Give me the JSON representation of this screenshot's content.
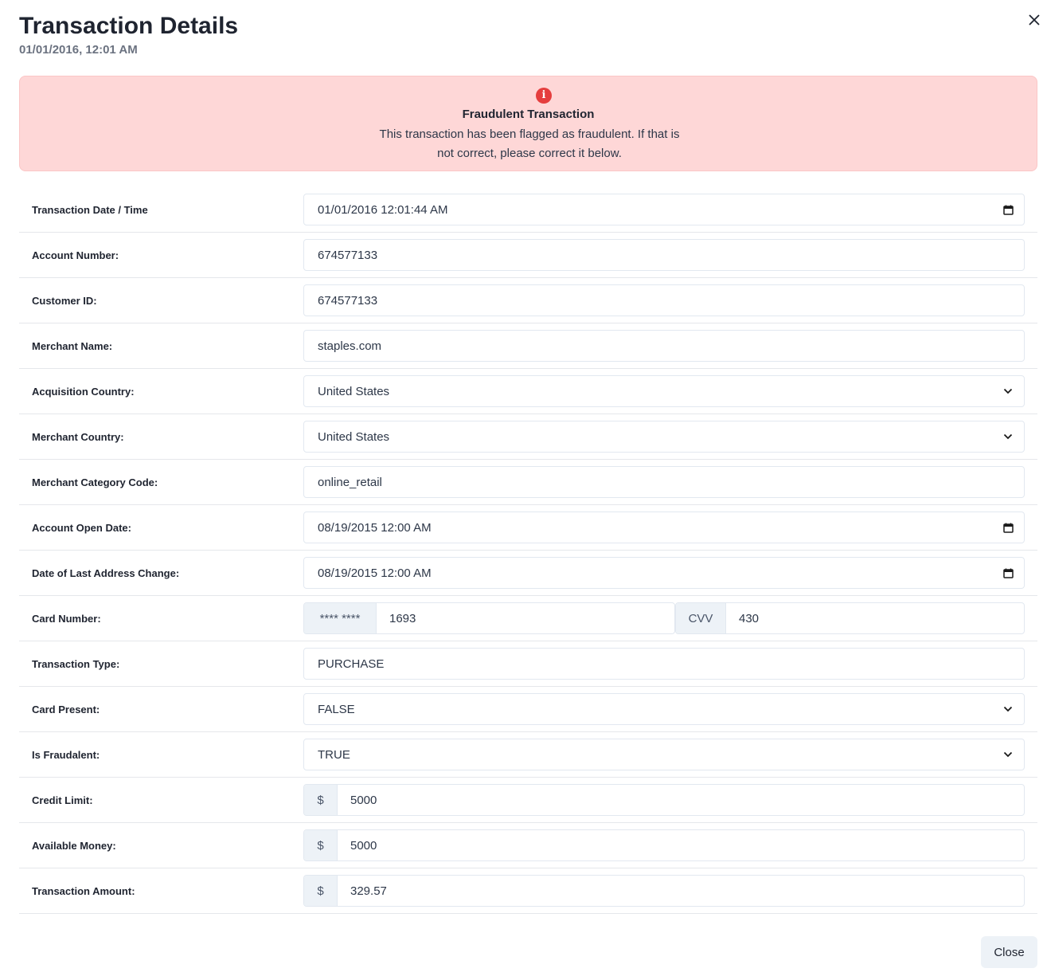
{
  "modal": {
    "title": "Transaction Details",
    "subtitle": "01/01/2016, 12:01 AM",
    "close_label": "Close"
  },
  "alert": {
    "title": "Fraudulent Transaction",
    "description": "This transaction has been flagged as fraudulent. If that is not correct, please correct it below.",
    "icon": "info-circle-icon",
    "icon_glyph": "i",
    "background": "#fed7d7",
    "icon_color": "#e53e3e"
  },
  "fields": {
    "transaction_datetime": {
      "label": "Transaction Date / Time",
      "value": "01/01/2016 12:01:44 AM"
    },
    "account_number": {
      "label": "Account Number:",
      "value": "674577133"
    },
    "customer_id": {
      "label": "Customer ID:",
      "value": "674577133"
    },
    "merchant_name": {
      "label": "Merchant Name:",
      "value": "staples.com"
    },
    "acquisition_country": {
      "label": "Acquisition Country:",
      "value": "United States"
    },
    "merchant_country": {
      "label": "Merchant Country:",
      "value": "United States"
    },
    "merchant_category_code": {
      "label": "Merchant Category Code:",
      "value": "online_retail"
    },
    "account_open_date": {
      "label": "Account Open Date:",
      "value": "08/19/2015 12:00 AM"
    },
    "last_address_change": {
      "label": "Date of Last Address Change:",
      "value": "08/19/2015 12:00 AM"
    },
    "card_number": {
      "label": "Card Number:",
      "mask": "**** ****",
      "value": "1693",
      "cvv_label": "CVV",
      "cvv_value": "430"
    },
    "transaction_type": {
      "label": "Transaction Type:",
      "value": "PURCHASE"
    },
    "card_present": {
      "label": "Card Present:",
      "value": "FALSE"
    },
    "is_fraudulent": {
      "label": "Is Fraudalent:",
      "value": "TRUE"
    },
    "credit_limit": {
      "label": "Credit Limit:",
      "currency": "$",
      "value": "5000"
    },
    "available_money": {
      "label": "Available Money:",
      "currency": "$",
      "value": "5000"
    },
    "transaction_amount": {
      "label": "Transaction Amount:",
      "currency": "$",
      "value": "329.57"
    }
  }
}
